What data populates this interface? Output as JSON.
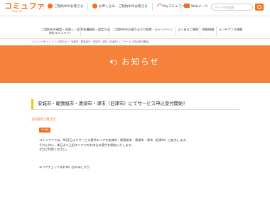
{
  "header": {
    "logo_text": "コミュファ",
    "logo_sub": "from ctc",
    "links": [
      {
        "label": "ご契約中のお客さま",
        "icon": "user-icon"
      },
      {
        "label": "お申し込み・ご契約中のお客さま",
        "icon": "cart-icon"
      },
      {
        "label": "Myコミュファ",
        "icon": "my-commufa-icon"
      },
      {
        "label": "Webメール",
        "icon": "mail-icon"
      }
    ],
    "search_placeholder": "サイト内を検索"
  },
  "nav": {
    "items": [
      {
        "line1": "ご契約中の確認・見直し・変更",
        "line2": "(Myコミュファ)"
      },
      {
        "line1": "各種接続・設定方法",
        "line2": ""
      },
      {
        "line1": "ご契約中のお客さまだけ割得・キャンペーン",
        "line2": ""
      },
      {
        "line1": "よくあるご質問",
        "line2": ""
      },
      {
        "line1": "障害情報",
        "line2": ""
      },
      {
        "line1": "メンテナンス情報",
        "line2": ""
      }
    ]
  },
  "breadcrumb": "コミュファ光 トップ ＞ お知らせ ＞ 安城市・尾張旭市・清須市・津市（旧津市）にてサービス申込受付開始！",
  "hero": {
    "title": "お知らせ"
  },
  "article": {
    "title": "安城市・尾張旭市・清須市・津市（旧津市）にてサービス申込受付開始！",
    "date": "2008年7月3日",
    "badge": "その他",
    "body": [
      "コミュファでは、9月1日よりサービス提供エリアを安城市・尾張旭市・清須市・津市（旧津市）に拡大します。",
      "それに伴い、本日より上記エリアでのお申込み受付を開始いたします。",
      "ぜひご利用ください。"
    ],
    "link": "エリアチェック＆お申し込みはこちら"
  },
  "colors": {
    "accent": "#f36e1c",
    "hero_bg": "#f5813a",
    "title_bar": "#f5c518"
  }
}
